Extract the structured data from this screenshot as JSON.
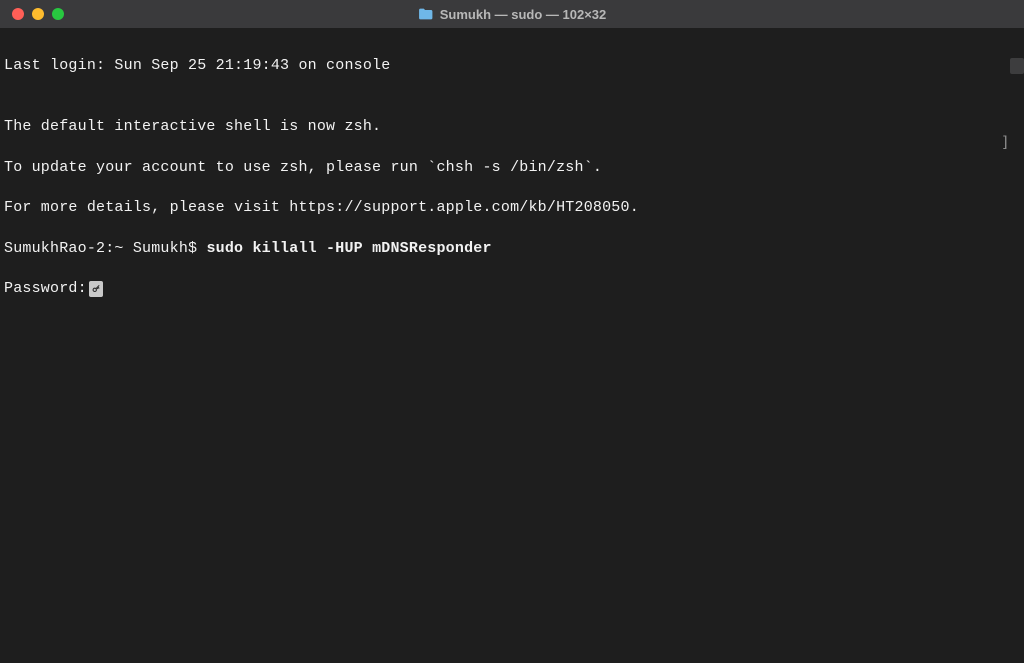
{
  "titlebar": {
    "title": "Sumukh — sudo — 102×32",
    "folder_icon": "folder-icon"
  },
  "terminal": {
    "last_login": "Last login: Sun Sep 25 21:19:43 on console",
    "blank1": "",
    "zsh_line1": "The default interactive shell is now zsh.",
    "zsh_line2": "To update your account to use zsh, please run `chsh -s /bin/zsh`.",
    "zsh_line3": "For more details, please visit https://support.apple.com/kb/HT208050.",
    "prompt": "SumukhRao-2:~ Sumukh$ ",
    "command": "sudo killall -HUP mDNSResponder",
    "password_label": "Password:",
    "right_bracket": "]"
  }
}
